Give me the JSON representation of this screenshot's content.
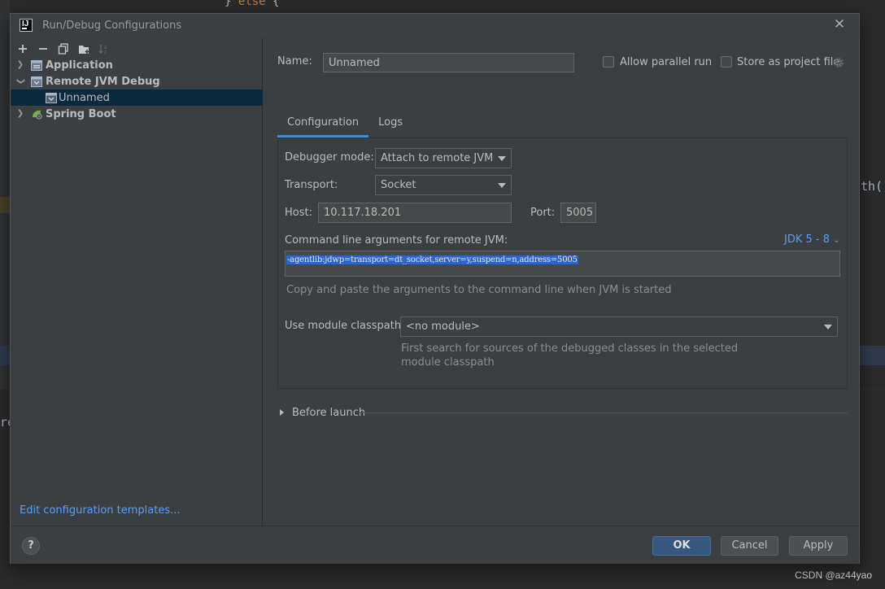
{
  "editor": {
    "top_code_brace": "}",
    "top_code_keyword": "else",
    "top_code_tail": " {",
    "right_fragment": "th()",
    "left_fragment": "re"
  },
  "watermark": "CSDN @az44yao",
  "dialog": {
    "title": "Run/Debug Configurations",
    "close_icon": "close-icon"
  },
  "toolbar": {
    "add": "+",
    "remove": "−",
    "copy": "copy-icon",
    "folder": "new-folder-icon",
    "sort": "sort-icon"
  },
  "tree": {
    "items": [
      {
        "label": "Application",
        "icon": "application-icon",
        "expanded": false
      },
      {
        "label": "Remote JVM Debug",
        "icon": "remote-debug-icon",
        "expanded": true
      },
      {
        "label": "Unnamed",
        "icon": "remote-debug-config-icon",
        "selected": true
      },
      {
        "label": "Spring Boot",
        "icon": "spring-boot-icon",
        "expanded": false
      }
    ]
  },
  "left_footer": {
    "edit_templates_label": "Edit configuration templates..."
  },
  "header": {
    "name_label": "Name:",
    "name_value": "Unnamed",
    "allow_parallel_label": "Allow parallel run",
    "store_project_label": "Store as project file",
    "gear_icon": "gear-icon"
  },
  "tabs": [
    {
      "label": "Configuration",
      "active": true
    },
    {
      "label": "Logs",
      "active": false
    }
  ],
  "config": {
    "debugger_mode_label": "Debugger mode:",
    "debugger_mode_value": "Attach to remote JVM",
    "transport_label": "Transport:",
    "transport_value": "Socket",
    "host_label": "Host:",
    "host_value": "10.117.18.201",
    "port_label": "Port:",
    "port_value": "5005",
    "cmd_args_label": "Command line arguments for remote JVM:",
    "jdk_link": "JDK 5 - 8",
    "cmd_args_value": "-agentlib:jdwp=transport=dt_socket,server=y,suspend=n,address=5005",
    "copy_hint": "Copy and paste the arguments to the command line when JVM is started",
    "module_label": "Use module classpath:",
    "module_value": "<no module>",
    "module_hint_line1": "First search for sources of the debugged classes in the selected",
    "module_hint_line2": "module classpath"
  },
  "before_launch": {
    "label": "Before launch"
  },
  "footer": {
    "help_label": "?",
    "ok_label": "OK",
    "cancel_label": "Cancel",
    "apply_label": "Apply"
  },
  "colors": {
    "dialog_bg": "#3c3f41",
    "selection_bg": "#0d293e",
    "link": "#589df6",
    "primary_button": "#365880",
    "tab_underline": "#4a88c7",
    "args_highlight": "#2f65ca"
  }
}
